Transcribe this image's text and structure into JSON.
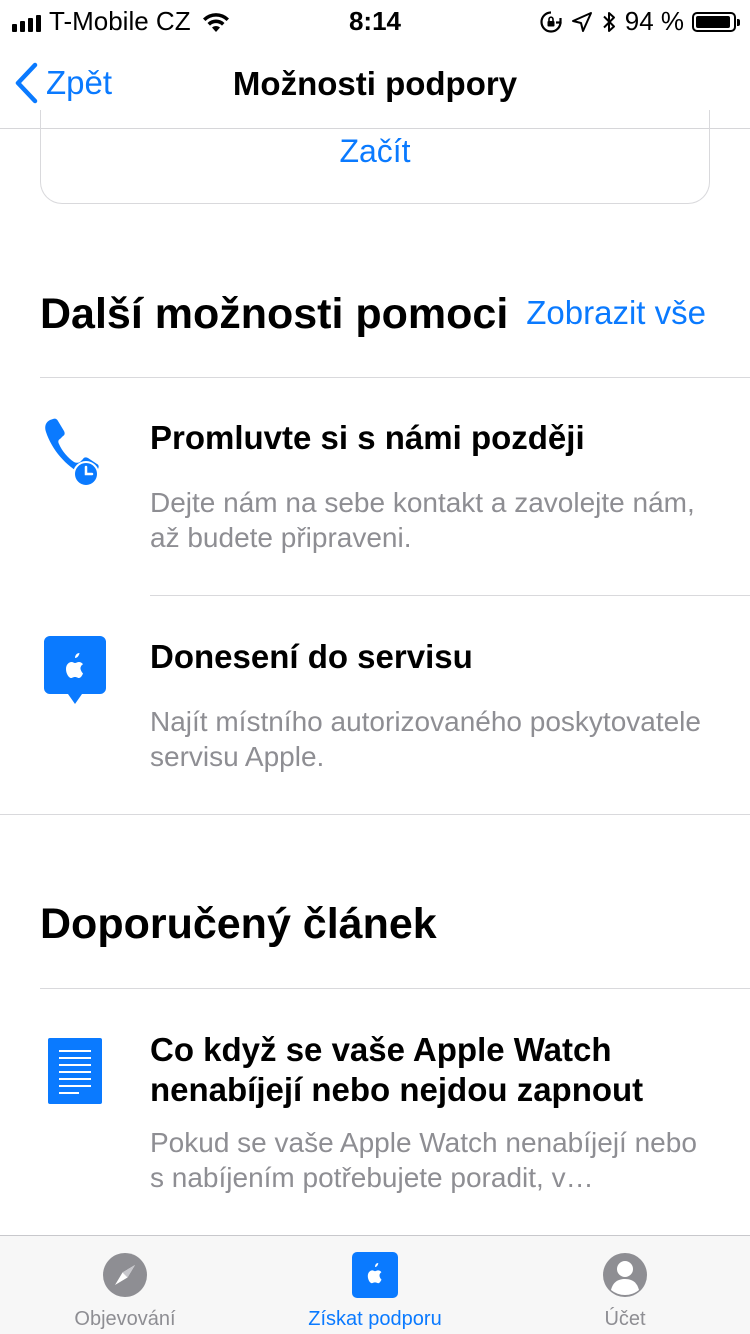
{
  "status_bar": {
    "carrier": "T-Mobile CZ",
    "time": "8:14",
    "battery_percent": "94 %",
    "battery_level": 0.94
  },
  "nav": {
    "back_label": "Zpět",
    "title": "Možnosti podpory"
  },
  "start_card": {
    "link_label": "Začít"
  },
  "more_help": {
    "title": "Další možnosti pomoci",
    "see_all_label": "Zobrazit vše",
    "items": [
      {
        "icon": "phone-clock-icon",
        "title": "Promluvte si s námi později",
        "description": "Dejte nám na sebe kontakt a zavolejte nám, až budete připraveni."
      },
      {
        "icon": "apple-store-pin-icon",
        "title": "Donesení do servisu",
        "description": "Najít místního autorizovaného poskytovatele servisu Apple."
      }
    ]
  },
  "recommended": {
    "title": "Doporučený článek",
    "items": [
      {
        "icon": "document-icon",
        "title": "Co když se vaše Apple Watch nenabíjejí nebo nejdou zapnout",
        "description": "Pokud se vaše Apple Watch nenabíjejí nebo s nabíjením potřebujete poradit, v…"
      }
    ]
  },
  "tab_bar": {
    "tabs": [
      {
        "label": "Objevování",
        "icon": "compass-icon",
        "active": false
      },
      {
        "label": "Získat podporu",
        "icon": "apple-support-icon",
        "active": true
      },
      {
        "label": "Účet",
        "icon": "person-icon",
        "active": false
      }
    ]
  },
  "colors": {
    "accent": "#0a7aff",
    "secondary_text": "#8e8e93",
    "divider": "#d9d9dc"
  }
}
